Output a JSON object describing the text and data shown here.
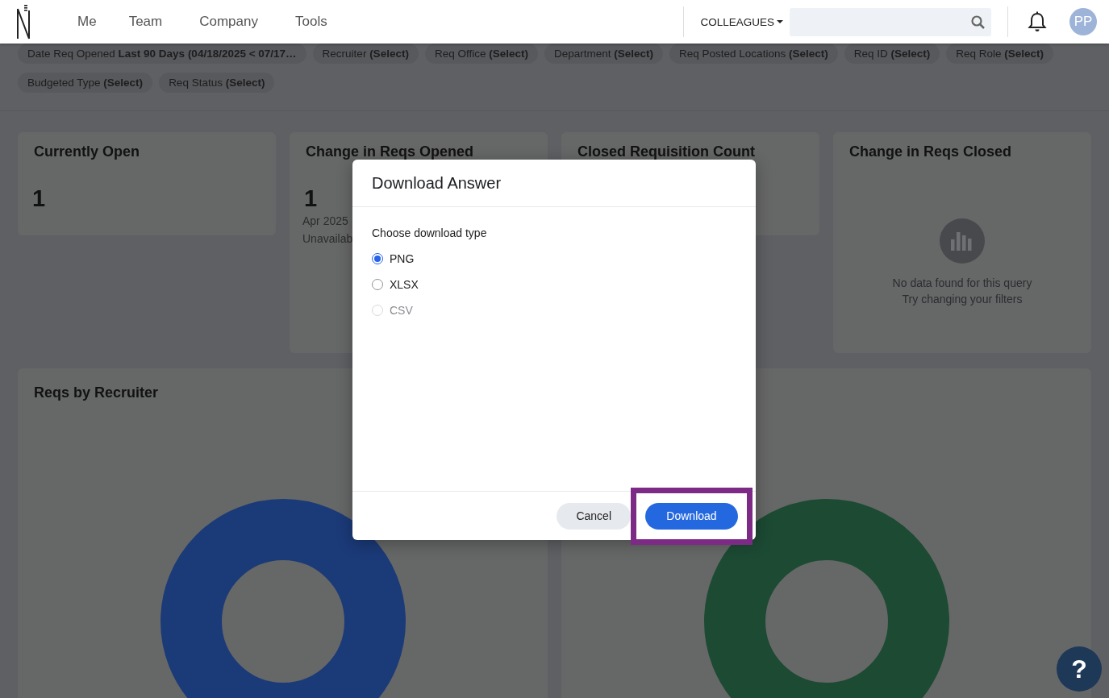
{
  "header": {
    "nav": [
      {
        "label": "Me"
      },
      {
        "label": "Team"
      },
      {
        "label": "Company"
      },
      {
        "label": "Tools"
      }
    ],
    "search_scope": "COLLEAGUES",
    "avatar_initials": "PP"
  },
  "filters": [
    {
      "text": "Date Req Opened **Last 90 Days (04/18/2025 < 07/17…**"
    },
    {
      "text": "Recruiter **(Select)**"
    },
    {
      "text": "Req Office **(Select)**"
    },
    {
      "text": "Department **(Select)**"
    },
    {
      "text": "Req Posted Locations **(Select)**"
    },
    {
      "text": "Req ID **(Select)**"
    },
    {
      "text": "Req Role **(Select)**"
    },
    {
      "text": "Budgeted Type **(Select)**"
    },
    {
      "text": "Req Status **(Select)**"
    }
  ],
  "stat_cards": [
    {
      "kind": "value",
      "title": "Currently Open",
      "value": "1"
    },
    {
      "kind": "change",
      "title": "Change in Reqs Opened",
      "value": "1",
      "period": "Apr 2025",
      "note": "Unavailab"
    },
    {
      "kind": "value",
      "title": "Closed Requisition Count"
    },
    {
      "kind": "empty",
      "title": "Change in Reqs Closed",
      "message": "No data found for this query",
      "hint": "Try changing your filters"
    }
  ],
  "chart_cards": [
    {
      "title": "Reqs by Recruiter",
      "color": "#1b3a78"
    },
    {
      "color": "#1c4a33"
    }
  ],
  "dialog": {
    "title": "Download Answer",
    "prompt": "Choose download type",
    "options": [
      {
        "label": "PNG",
        "selected": true,
        "disabled": false
      },
      {
        "label": "XLSX",
        "selected": false,
        "disabled": false
      },
      {
        "label": "CSV",
        "selected": false,
        "disabled": true
      }
    ],
    "buttons": [
      {
        "label": "Cancel",
        "kind": "secondary",
        "highlighted": false
      },
      {
        "label": "Download",
        "kind": "primary",
        "highlighted": true
      }
    ]
  },
  "help": {
    "label": "?"
  }
}
